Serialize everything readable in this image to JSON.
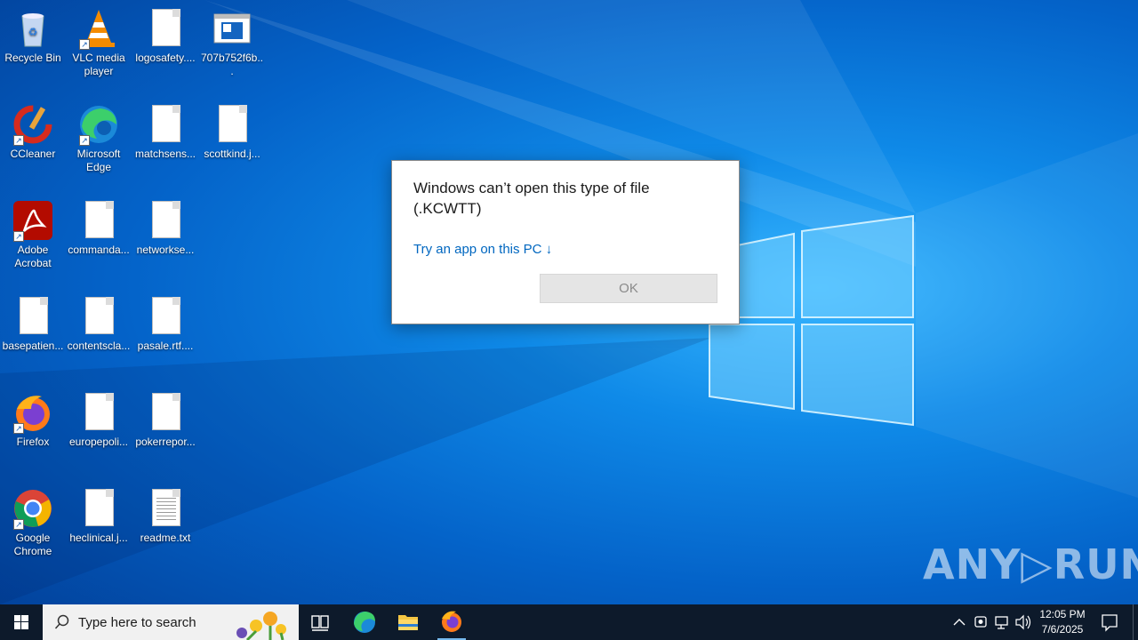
{
  "desktop_icons": [
    {
      "label": "Recycle Bin"
    },
    {
      "label": "VLC media player"
    },
    {
      "label": "logosafety...."
    },
    {
      "label": "707b752f6b..."
    },
    {
      "label": "CCleaner"
    },
    {
      "label": "Microsoft Edge"
    },
    {
      "label": "matchsens..."
    },
    {
      "label": "scottkind.j..."
    },
    {
      "label": "Adobe Acrobat"
    },
    {
      "label": "commanda..."
    },
    {
      "label": "networkse..."
    },
    {
      "label": "basepatien..."
    },
    {
      "label": "contentscla..."
    },
    {
      "label": "pasale.rtf...."
    },
    {
      "label": "Firefox"
    },
    {
      "label": "europepoli..."
    },
    {
      "label": "pokerrepor..."
    },
    {
      "label": "Google Chrome"
    },
    {
      "label": "heclinical.j..."
    },
    {
      "label": "readme.txt"
    }
  ],
  "dialog": {
    "title": "Windows can’t open this type of file (.KCWTT)",
    "link": "Try an app on this PC ↓",
    "ok_label": "OK"
  },
  "watermark": "ANY▷RUN",
  "taskbar": {
    "search_placeholder": "Type here to search",
    "time": "12:05 PM",
    "date": "7/6/2025"
  },
  "colors": {
    "accent_link": "#0067c0",
    "taskbar_bg": "#0d1a2b",
    "desktop_blue": "#0f8ae8"
  }
}
